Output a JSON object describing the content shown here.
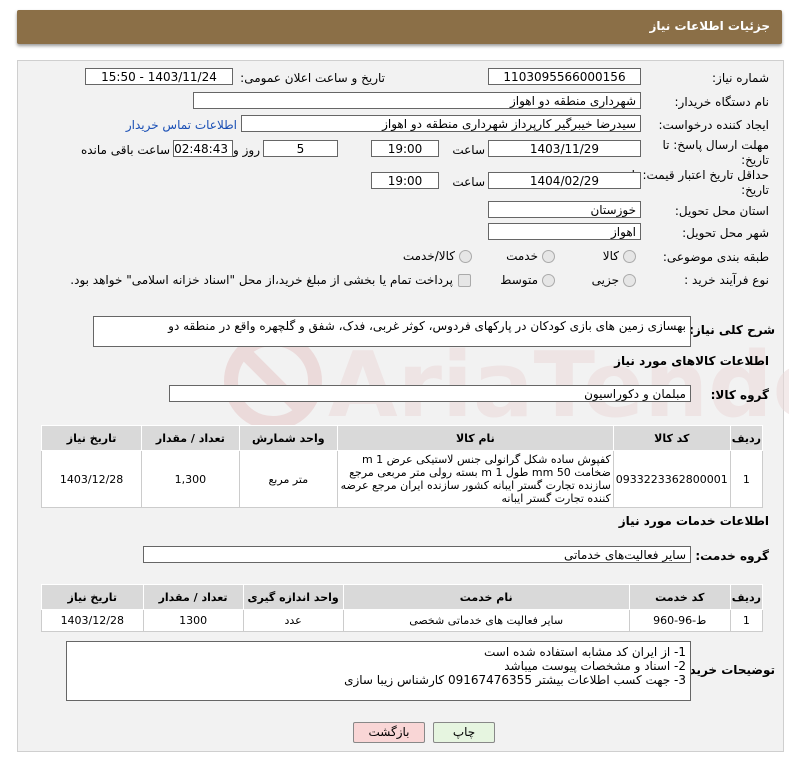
{
  "header": {
    "title": "جزئیات اطلاعات نیاز"
  },
  "fields": {
    "need_number_label": "شماره نیاز:",
    "need_number": "1103095566000156",
    "announce_label": "تاریخ و ساعت اعلان عمومی:",
    "announce_value": "1403/11/24 - 15:50",
    "buyer_org_label": "نام دستگاه خریدار:",
    "buyer_org": "شهرداری منطقه دو اهواز",
    "creator_label": "ایجاد کننده درخواست:",
    "creator": "سیدرضا خیبرگیر کارپرداز  شهرداری منطقه دو اهواز",
    "contact_link": "اطلاعات تماس خریدار",
    "deadline_label_1": "مهلت ارسال پاسخ: تا",
    "deadline_label_2": "تاریخ:",
    "deadline_date": "1403/11/29",
    "time_label": "ساعت",
    "deadline_time": "19:00",
    "days_value": "5",
    "days_label": "روز و",
    "remaining_time": "02:48:43",
    "remaining_label": "ساعت باقی مانده",
    "validity_label_1": "حداقل تاریخ اعتبار قیمت: تا",
    "validity_label_2": "تاریخ:",
    "validity_date": "1404/02/29",
    "validity_time": "19:00",
    "province_label": "استان محل تحویل:",
    "province": "خوزستان",
    "city_label": "شهر محل تحویل:",
    "city": "اهواز",
    "category_label": "طبقه بندی موضوعی:",
    "category_options": [
      "کالا",
      "خدمت",
      "کالا/خدمت"
    ],
    "process_label": "نوع فرآیند خرید :",
    "process_options": [
      "جزیی",
      "متوسط"
    ],
    "payment_note": "پرداخت تمام یا بخشی از مبلغ خرید،از محل \"اسناد خزانه اسلامی\" خواهد بود."
  },
  "description": {
    "label": "شرح کلی نیاز:",
    "text": "بهسازی زمین های بازی کودکان در پارکهای فردوس، کوثر غربی، فدک، شفق و گلچهره واقع در منطقه دو"
  },
  "goods": {
    "section_title": "اطلاعات کالاهای مورد نیاز",
    "group_label": "گروه کالا:",
    "group_value": "مبلمان و دکوراسیون",
    "columns": [
      "ردیف",
      "کد کالا",
      "نام کالا",
      "واحد شمارش",
      "تعداد / مقدار",
      "تاریخ نیاز"
    ],
    "rows": [
      {
        "row": "1",
        "code": "0933223362800001",
        "name": "کفپوش ساده شکل گرانولی جنس لاستیکی عرض 1 m ضخامت 50 mm طول 1 m بسته رولی متر مربعی مرجع سازنده تجارت گستر ایبانه کشور سازنده ایران مرجع عرضه کننده تجارت گستر ایبانه",
        "unit": "متر مربع",
        "qty": "1,300",
        "date": "1403/12/28"
      }
    ]
  },
  "services": {
    "section_title": "اطلاعات خدمات مورد نیاز",
    "group_label": "گروه خدمت:",
    "group_value": "سایر فعالیت‌های خدماتی",
    "columns": [
      "ردیف",
      "کد خدمت",
      "نام خدمت",
      "واحد اندازه گیری",
      "تعداد / مقدار",
      "تاریخ نیاز"
    ],
    "rows": [
      {
        "row": "1",
        "code": "ط-96-960",
        "name": "سایر فعالیت های خدماتی شخصی",
        "unit": "عدد",
        "qty": "1300",
        "date": "1403/12/28"
      }
    ]
  },
  "buyer_notes": {
    "label": "توضیحات خریدار:",
    "lines": [
      "1- از ایران کد مشابه استفاده شده است",
      "2- اسناد و مشخصات پیوست میباشد",
      "3- جهت کسب اطلاعات بیشتر 09167476355 کارشناس زیبا سازی"
    ]
  },
  "buttons": {
    "print": "چاپ",
    "back": "بازگشت"
  },
  "colors": {
    "header": "#8b6f47",
    "panel": "#f2f2f2",
    "link": "#1a4fb5",
    "back_btn": "#f9d6d6",
    "print_btn": "#e6f5e0"
  }
}
